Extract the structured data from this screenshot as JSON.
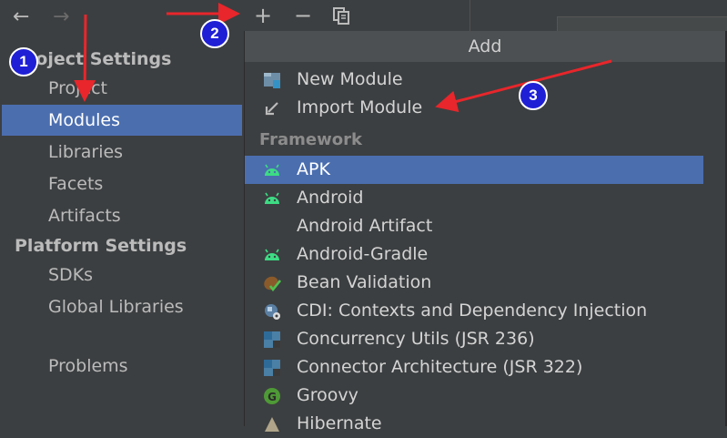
{
  "nav": {
    "back_glyph": "←",
    "forward_glyph": "→"
  },
  "left_panel": {
    "project_settings_header": "Project Settings",
    "project_items": [
      {
        "label": "Project"
      },
      {
        "label": "Modules"
      },
      {
        "label": "Libraries"
      },
      {
        "label": "Facets"
      },
      {
        "label": "Artifacts"
      }
    ],
    "platform_settings_header": "Platform Settings",
    "platform_items": [
      {
        "label": "SDKs"
      },
      {
        "label": "Global Libraries"
      }
    ],
    "problems_label": "Problems"
  },
  "toolbar": {
    "add_glyph": "+",
    "remove_glyph": "−",
    "copy_icon": "copy-icon"
  },
  "popup": {
    "title": "Add",
    "top_items": [
      {
        "label": "New Module",
        "icon": "module-icon"
      },
      {
        "label": "Import Module",
        "icon": "import-icon"
      }
    ],
    "framework_header": "Framework",
    "framework_items": [
      {
        "label": "APK",
        "icon": "android-icon"
      },
      {
        "label": "Android",
        "icon": "android-icon"
      },
      {
        "label": "Android Artifact",
        "icon": ""
      },
      {
        "label": "Android-Gradle",
        "icon": "android-icon"
      },
      {
        "label": "Bean Validation",
        "icon": "bean-validation-icon"
      },
      {
        "label": "CDI: Contexts and Dependency Injection",
        "icon": "cdi-icon"
      },
      {
        "label": "Concurrency Utils (JSR 236)",
        "icon": "jsr-icon"
      },
      {
        "label": "Connector Architecture (JSR 322)",
        "icon": "jsr-icon"
      },
      {
        "label": "Groovy",
        "icon": "groovy-icon"
      },
      {
        "label": "Hibernate",
        "icon": "hibernate-icon"
      }
    ],
    "selected": "APK"
  },
  "annotations": [
    {
      "number": "1"
    },
    {
      "number": "2"
    },
    {
      "number": "3"
    }
  ],
  "colors": {
    "selection": "#4b6eaf",
    "panel_bg": "#3c3f41",
    "android_green": "#3ddc84",
    "annotation_arrow": "#e8262b",
    "badge_blue": "#1f1fd6"
  }
}
